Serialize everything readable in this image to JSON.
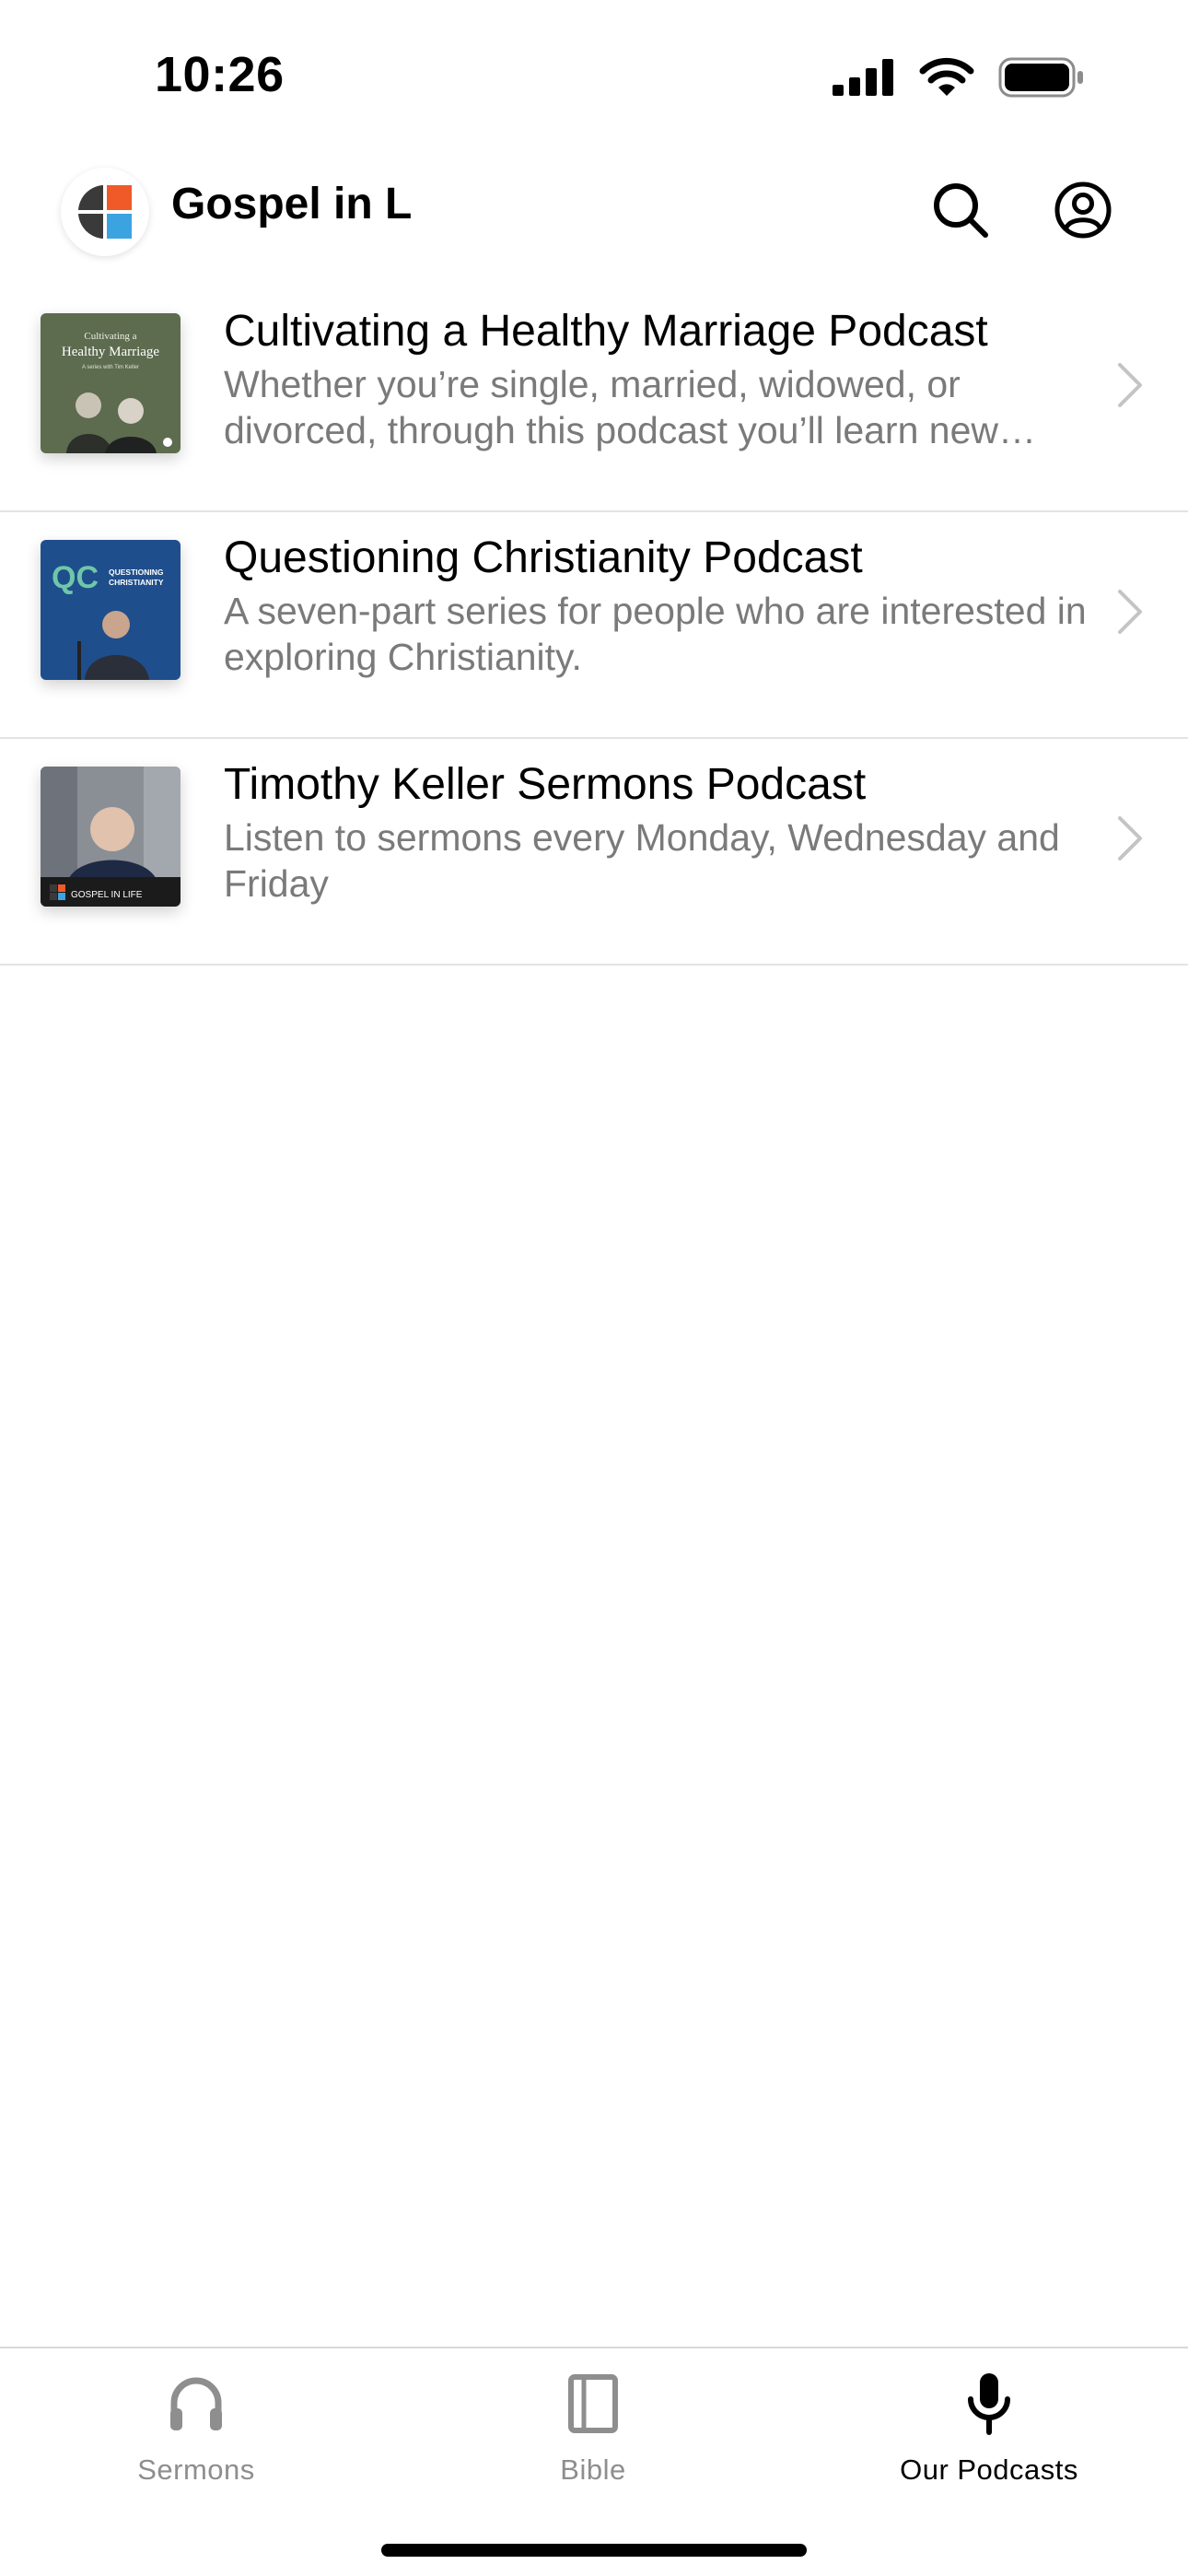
{
  "status_bar": {
    "time": "10:26"
  },
  "header": {
    "title": "Gospel in L",
    "search_icon": "search-icon",
    "account_icon": "account-circle-icon",
    "logo_colors": [
      "#f05a28",
      "#3ba3e0",
      "#3a3a3a"
    ]
  },
  "podcasts": [
    {
      "title": "Cultivating a Healthy Marriage Podcast",
      "description": "Whether you’re single, married, widowed, or divorced, through this podcast you’ll learn new ways to cultivate a healthy marriage.",
      "cover": {
        "line1": "Cultivating a",
        "line2": "Healthy Marriage",
        "line3": "A series with Tim Keller"
      }
    },
    {
      "title": "Questioning Christianity Podcast",
      "description": "A seven-part series for people who are interested in exploring Christianity.",
      "cover": {
        "mark": "QC",
        "line1": "QUESTIONING",
        "line2": "CHRISTIANITY"
      }
    },
    {
      "title": "Timothy Keller Sermons Podcast",
      "description": "Listen to sermons every Monday, Wednesday and Friday",
      "cover": {
        "brand": "GOSPEL IN LIFE"
      }
    }
  ],
  "tabs": [
    {
      "label": "Sermons",
      "icon": "headphones-icon",
      "active": false
    },
    {
      "label": "Bible",
      "icon": "book-icon",
      "active": false
    },
    {
      "label": "Our Podcasts",
      "icon": "microphone-icon",
      "active": true
    }
  ],
  "colors": {
    "active_tab": "#000000",
    "inactive_tab": "#8e8e8e",
    "description_text": "#7a7a7a"
  }
}
